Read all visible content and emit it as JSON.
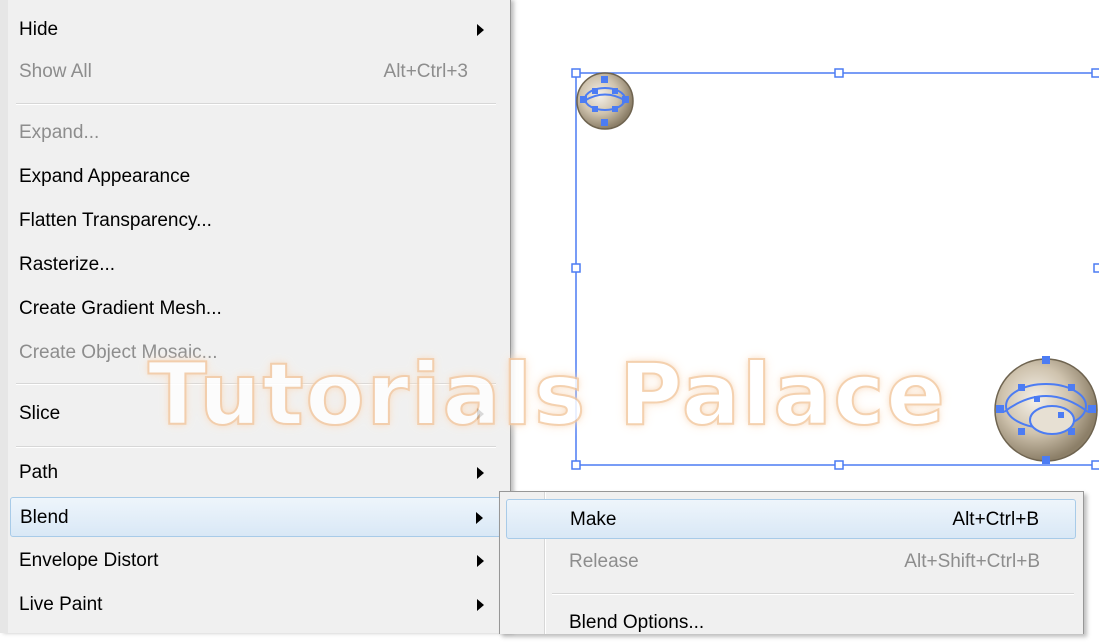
{
  "menu": {
    "items": [
      {
        "label": "Hide",
        "shortcut": "",
        "submenu": true,
        "disabled": false
      },
      {
        "label": "Show All",
        "shortcut": "Alt+Ctrl+3",
        "submenu": false,
        "disabled": true
      },
      {
        "label": "Expand...",
        "shortcut": "",
        "submenu": false,
        "disabled": true
      },
      {
        "label": "Expand Appearance",
        "shortcut": "",
        "submenu": false,
        "disabled": false
      },
      {
        "label": "Flatten Transparency...",
        "shortcut": "",
        "submenu": false,
        "disabled": false
      },
      {
        "label": "Rasterize...",
        "shortcut": "",
        "submenu": false,
        "disabled": false
      },
      {
        "label": "Create Gradient Mesh...",
        "shortcut": "",
        "submenu": false,
        "disabled": false
      },
      {
        "label": "Create Object Mosaic...",
        "shortcut": "",
        "submenu": false,
        "disabled": true
      },
      {
        "label": "Slice",
        "shortcut": "",
        "submenu": true,
        "disabled": false
      },
      {
        "label": "Path",
        "shortcut": "",
        "submenu": true,
        "disabled": false
      },
      {
        "label": "Blend",
        "shortcut": "",
        "submenu": true,
        "disabled": false,
        "highlighted": true
      },
      {
        "label": "Envelope Distort",
        "shortcut": "",
        "submenu": true,
        "disabled": false
      },
      {
        "label": "Live Paint",
        "shortcut": "",
        "submenu": true,
        "disabled": false
      }
    ]
  },
  "submenu": {
    "items": [
      {
        "label": "Make",
        "shortcut": "Alt+Ctrl+B",
        "disabled": false,
        "highlighted": true
      },
      {
        "label": "Release",
        "shortcut": "Alt+Shift+Ctrl+B",
        "disabled": true
      },
      {
        "label": "Blend Options...",
        "shortcut": "",
        "disabled": false
      }
    ]
  },
  "watermark": "Tutorials Palace",
  "colors": {
    "selection": "#4c7cf3",
    "highlight": "#d9e8f6"
  }
}
